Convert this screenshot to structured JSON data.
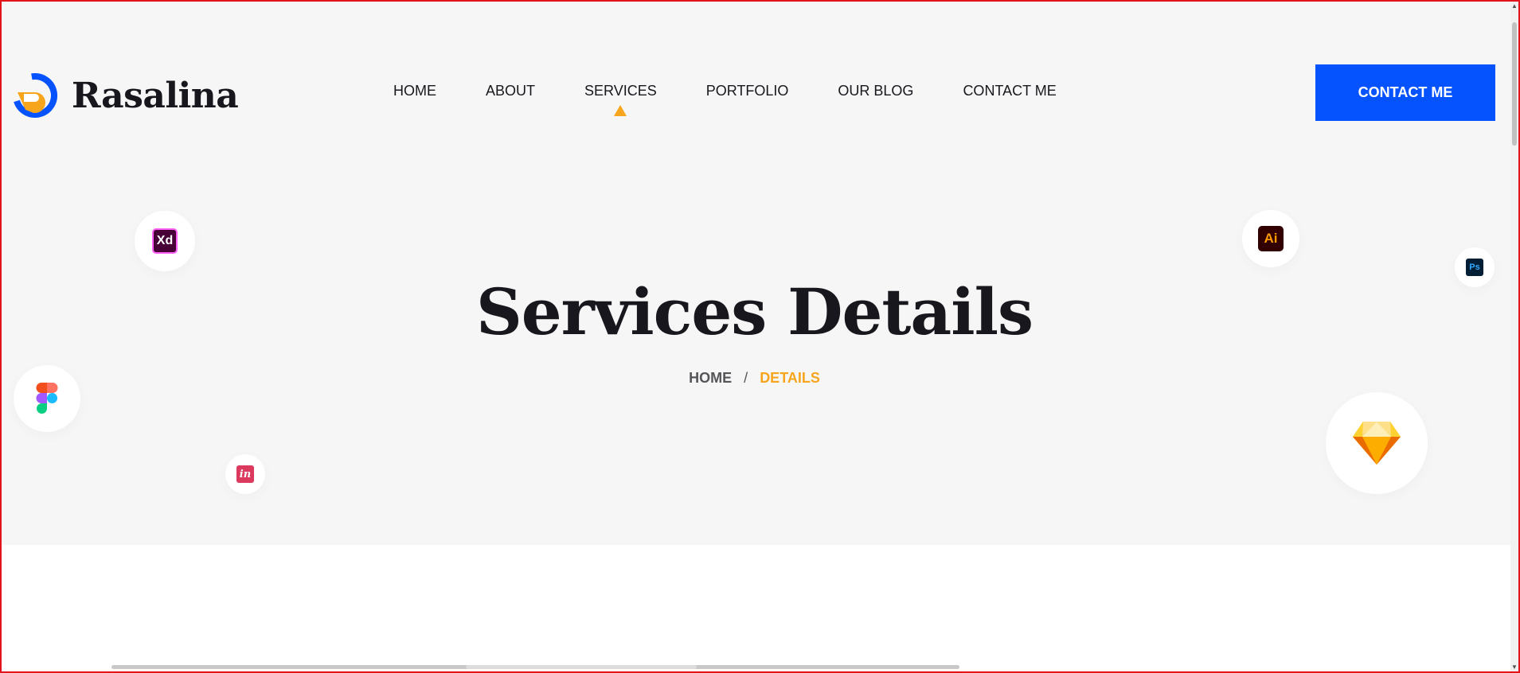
{
  "brand": {
    "name": "Rasalina"
  },
  "nav": {
    "items": [
      {
        "label": "HOME"
      },
      {
        "label": "ABOUT"
      },
      {
        "label": "SERVICES",
        "active": true
      },
      {
        "label": "PORTFOLIO"
      },
      {
        "label": "OUR BLOG"
      },
      {
        "label": "CONTACT ME"
      }
    ]
  },
  "header": {
    "cta_label": "CONTACT ME"
  },
  "banner": {
    "title": "Services Details",
    "breadcrumb": {
      "home": "HOME",
      "separator": "/",
      "current": "DETAILS"
    }
  },
  "tools": {
    "xd": "Xd",
    "ai": "Ai",
    "ps": "Ps",
    "invision": "in"
  },
  "colors": {
    "accent_orange": "#f7a51c",
    "accent_blue": "#0552ff",
    "hero_bg": "#f6f6f6",
    "text_dark": "#17171d"
  },
  "icons": [
    "logo-icon",
    "adobe-xd-icon",
    "adobe-illustrator-icon",
    "adobe-photoshop-icon",
    "figma-icon",
    "invision-icon",
    "sketch-icon"
  ]
}
